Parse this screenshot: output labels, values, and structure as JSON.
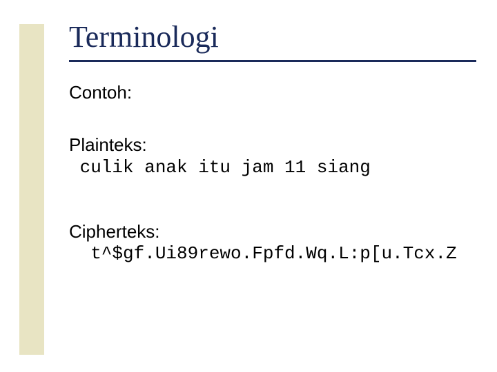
{
  "title": "Terminologi",
  "example_label": "Contoh:",
  "plaintext": {
    "label": "Plainteks:",
    "value": " culik anak itu jam 11 siang"
  },
  "ciphertext": {
    "label": "Cipherteks:",
    "value": "  t^$gf.Ui89rewo.Fpfd.Wq.L:p[u.Tcx.Z"
  }
}
